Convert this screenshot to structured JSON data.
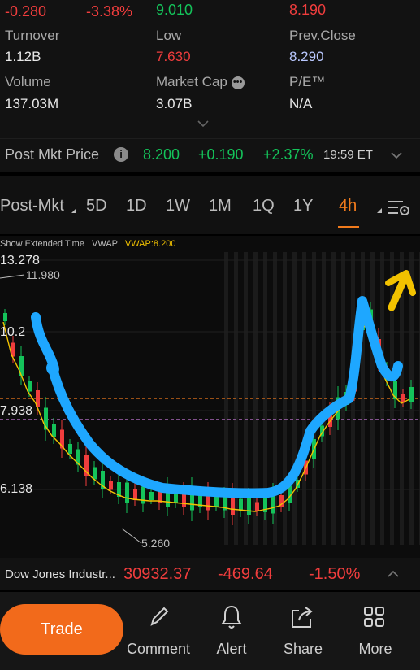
{
  "top": {
    "change": "-0.280",
    "change_pct": "-3.38%",
    "high_value": "9.010",
    "open_value": "8.190"
  },
  "stats": {
    "turnover_label": "Turnover",
    "turnover_value": "1.12B",
    "low_label": "Low",
    "low_value": "7.630",
    "prev_close_label": "Prev.Close",
    "prev_close_value": "8.290",
    "volume_label": "Volume",
    "volume_value": "137.03M",
    "market_cap_label": "Market Cap",
    "market_cap_value": "3.07B",
    "pe_label": "P/E™",
    "pe_value": "N/A"
  },
  "post_market": {
    "label": "Post Mkt Price",
    "price": "8.200",
    "change": "+0.190",
    "change_pct": "+2.37%",
    "time": "19:59 ET"
  },
  "tabs": [
    "Post-Mkt",
    "5D",
    "1D",
    "1W",
    "1M",
    "1Q",
    "1Y",
    "4h"
  ],
  "active_tab": "4h",
  "chart_header": {
    "show_extended": "Show Extended Time",
    "vwap": "VWAP",
    "vwap_value": "VWAP:8.200"
  },
  "chart_data": {
    "type": "candlestick",
    "y_ticks": [
      "13.278",
      "10.2",
      "7.938",
      "6.138"
    ],
    "high_marker": "11.980",
    "low_marker": "5.260",
    "reference_line": 7.938
  },
  "index_ticker": {
    "name": "Dow Jones Industr...",
    "value": "30932.37",
    "change": "-469.64",
    "change_pct": "-1.50%"
  },
  "bottom_nav": {
    "trade": "Trade",
    "items": [
      "Comment",
      "Alert",
      "Share",
      "More"
    ]
  },
  "colors": {
    "accent": "#f26a1b",
    "up": "#14c35a",
    "down": "#f03d3d",
    "annotation": "#1ea7ff",
    "vwap": "#f2c200"
  }
}
